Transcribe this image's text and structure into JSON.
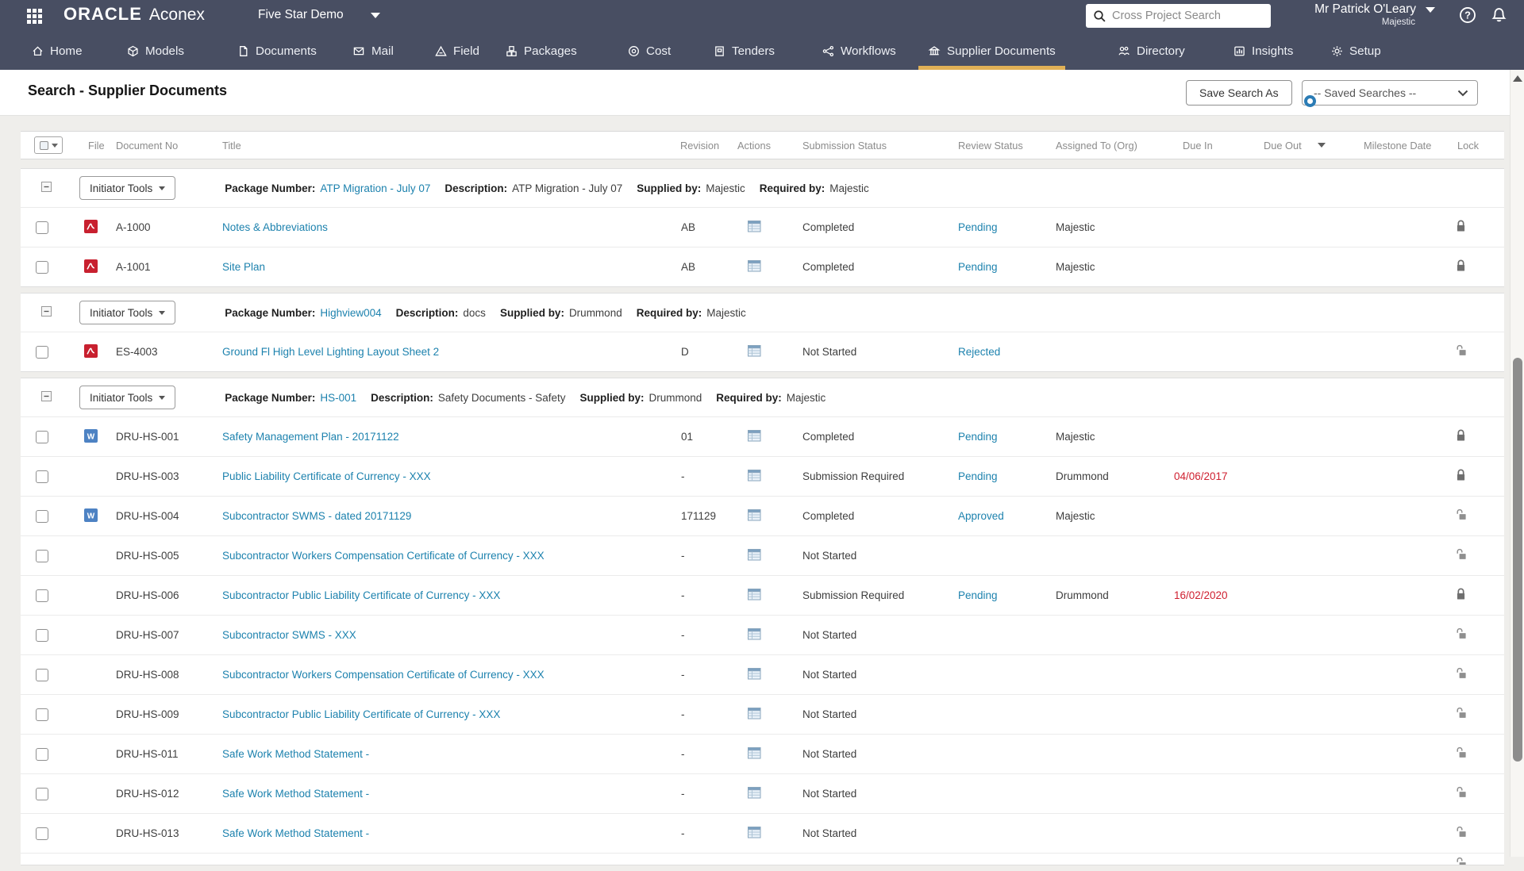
{
  "colors": {
    "topbar": "#484e62",
    "accent_underline": "#e0b056",
    "link": "#1d82ae",
    "alert_date": "#cf2030"
  },
  "topbar": {
    "brand": {
      "oracle": "ORACLE",
      "product": "Aconex"
    },
    "project": {
      "name": "Five Star Demo"
    },
    "search": {
      "placeholder": "Cross Project Search"
    },
    "user": {
      "name": "Mr Patrick O'Leary",
      "org": "Majestic"
    },
    "nav": [
      {
        "id": "home",
        "label": "Home",
        "icon": "home-icon",
        "active": false
      },
      {
        "id": "models",
        "label": "Models",
        "icon": "models-icon",
        "active": false
      },
      {
        "id": "documents",
        "label": "Documents",
        "icon": "documents-icon",
        "active": false
      },
      {
        "id": "mail",
        "label": "Mail",
        "icon": "mail-icon",
        "active": false
      },
      {
        "id": "field",
        "label": "Field",
        "icon": "field-icon",
        "active": false
      },
      {
        "id": "packages",
        "label": "Packages",
        "icon": "packages-icon",
        "active": false
      },
      {
        "id": "cost",
        "label": "Cost",
        "icon": "cost-icon",
        "active": false
      },
      {
        "id": "tenders",
        "label": "Tenders",
        "icon": "tenders-icon",
        "active": false
      },
      {
        "id": "workflows",
        "label": "Workflows",
        "icon": "workflows-icon",
        "active": false
      },
      {
        "id": "supplierdocs",
        "label": "Supplier Documents",
        "icon": "supplier-documents-icon",
        "active": true
      },
      {
        "id": "directory",
        "label": "Directory",
        "icon": "directory-icon",
        "active": false
      },
      {
        "id": "insights",
        "label": "Insights",
        "icon": "insights-icon",
        "active": false
      },
      {
        "id": "setup",
        "label": "Setup",
        "icon": "setup-icon",
        "active": false
      }
    ]
  },
  "page": {
    "title": "Search - Supplier Documents",
    "save_search_button": "Save Search As",
    "saved_searches_dropdown": "-- Saved Searches --"
  },
  "table": {
    "columns": {
      "file": "File",
      "document_no": "Document No",
      "title": "Title",
      "revision": "Revision",
      "actions": "Actions",
      "submission_status": "Submission Status",
      "review_status": "Review Status",
      "assigned_to": "Assigned To (Org)",
      "due_in": "Due In",
      "due_out": "Due Out",
      "milestone_date": "Milestone Date",
      "lock": "Lock"
    },
    "group_labels": {
      "tools": "Initiator Tools",
      "package": "Package Number:",
      "description": "Description:",
      "supplied": "Supplied by:",
      "required": "Required by:"
    },
    "groups": [
      {
        "package_number": "ATP Migration - July 07",
        "description": "ATP Migration - July 07",
        "supplied_by": "Majestic",
        "required_by": "Majestic",
        "rows": [
          {
            "file_type": "pdf",
            "doc_no": "A-1000",
            "title": "Notes & Abbreviations",
            "revision": "AB",
            "submission_status": "Completed",
            "review_status": "Pending",
            "assigned_to": "Majestic",
            "due_in": "",
            "due_out": "",
            "milestone_date": "",
            "lock": "locked"
          },
          {
            "file_type": "pdf",
            "doc_no": "A-1001",
            "title": "Site Plan",
            "revision": "AB",
            "submission_status": "Completed",
            "review_status": "Pending",
            "assigned_to": "Majestic",
            "due_in": "",
            "due_out": "",
            "milestone_date": "",
            "lock": "locked"
          }
        ]
      },
      {
        "package_number": "Highview004",
        "description": "docs",
        "supplied_by": "Drummond",
        "required_by": "Majestic",
        "rows": [
          {
            "file_type": "pdf",
            "doc_no": "ES-4003",
            "title": "Ground Fl High Level Lighting Layout Sheet 2",
            "revision": "D",
            "submission_status": "Not Started",
            "review_status": "Rejected",
            "assigned_to": "",
            "due_in": "",
            "due_out": "",
            "milestone_date": "",
            "lock": "unlocked"
          }
        ]
      },
      {
        "package_number": "HS-001",
        "description": "Safety Documents - Safety",
        "supplied_by": "Drummond",
        "required_by": "Majestic",
        "rows": [
          {
            "file_type": "word",
            "doc_no": "DRU-HS-001",
            "title": "Safety Management Plan - 20171122",
            "revision": "01",
            "submission_status": "Completed",
            "review_status": "Pending",
            "assigned_to": "Majestic",
            "due_in": "",
            "due_out": "",
            "milestone_date": "",
            "lock": "locked"
          },
          {
            "file_type": "",
            "doc_no": "DRU-HS-003",
            "title": "Public Liability Certificate of Currency - XXX",
            "revision": "-",
            "submission_status": "Submission Required",
            "review_status": "Pending",
            "assigned_to": "Drummond",
            "due_in": "04/06/2017",
            "due_out": "",
            "milestone_date": "",
            "lock": "locked"
          },
          {
            "file_type": "word",
            "doc_no": "DRU-HS-004",
            "title": "Subcontractor SWMS - dated 20171129",
            "revision": "171129",
            "submission_status": "Completed",
            "review_status": "Approved",
            "assigned_to": "Majestic",
            "due_in": "",
            "due_out": "",
            "milestone_date": "",
            "lock": "unlocked"
          },
          {
            "file_type": "",
            "doc_no": "DRU-HS-005",
            "title": "Subcontractor Workers Compensation Certificate of Currency - XXX",
            "revision": "-",
            "submission_status": "Not Started",
            "review_status": "",
            "assigned_to": "",
            "due_in": "",
            "due_out": "",
            "milestone_date": "",
            "lock": "unlocked"
          },
          {
            "file_type": "",
            "doc_no": "DRU-HS-006",
            "title": "Subcontractor Public Liability Certificate of Currency - XXX",
            "revision": "-",
            "submission_status": "Submission Required",
            "review_status": "Pending",
            "assigned_to": "Drummond",
            "due_in": "16/02/2020",
            "due_out": "",
            "milestone_date": "",
            "lock": "locked"
          },
          {
            "file_type": "",
            "doc_no": "DRU-HS-007",
            "title": "Subcontractor SWMS - XXX",
            "revision": "-",
            "submission_status": "Not Started",
            "review_status": "",
            "assigned_to": "",
            "due_in": "",
            "due_out": "",
            "milestone_date": "",
            "lock": "unlocked"
          },
          {
            "file_type": "",
            "doc_no": "DRU-HS-008",
            "title": "Subcontractor Workers Compensation Certificate of Currency - XXX",
            "revision": "-",
            "submission_status": "Not Started",
            "review_status": "",
            "assigned_to": "",
            "due_in": "",
            "due_out": "",
            "milestone_date": "",
            "lock": "unlocked"
          },
          {
            "file_type": "",
            "doc_no": "DRU-HS-009",
            "title": "Subcontractor Public Liability Certificate of Currency - XXX",
            "revision": "-",
            "submission_status": "Not Started",
            "review_status": "",
            "assigned_to": "",
            "due_in": "",
            "due_out": "",
            "milestone_date": "",
            "lock": "unlocked"
          },
          {
            "file_type": "",
            "doc_no": "DRU-HS-011",
            "title": "Safe Work Method Statement -",
            "revision": "-",
            "submission_status": "Not Started",
            "review_status": "",
            "assigned_to": "",
            "due_in": "",
            "due_out": "",
            "milestone_date": "",
            "lock": "unlocked"
          },
          {
            "file_type": "",
            "doc_no": "DRU-HS-012",
            "title": "Safe Work Method Statement -",
            "revision": "-",
            "submission_status": "Not Started",
            "review_status": "",
            "assigned_to": "",
            "due_in": "",
            "due_out": "",
            "milestone_date": "",
            "lock": "unlocked"
          },
          {
            "file_type": "",
            "doc_no": "DRU-HS-013",
            "title": "Safe Work Method Statement -",
            "revision": "-",
            "submission_status": "Not Started",
            "review_status": "",
            "assigned_to": "",
            "due_in": "",
            "due_out": "",
            "milestone_date": "",
            "lock": "unlocked"
          }
        ]
      }
    ],
    "partial_next_row": {
      "visible": true,
      "lock": "unlocked"
    }
  }
}
